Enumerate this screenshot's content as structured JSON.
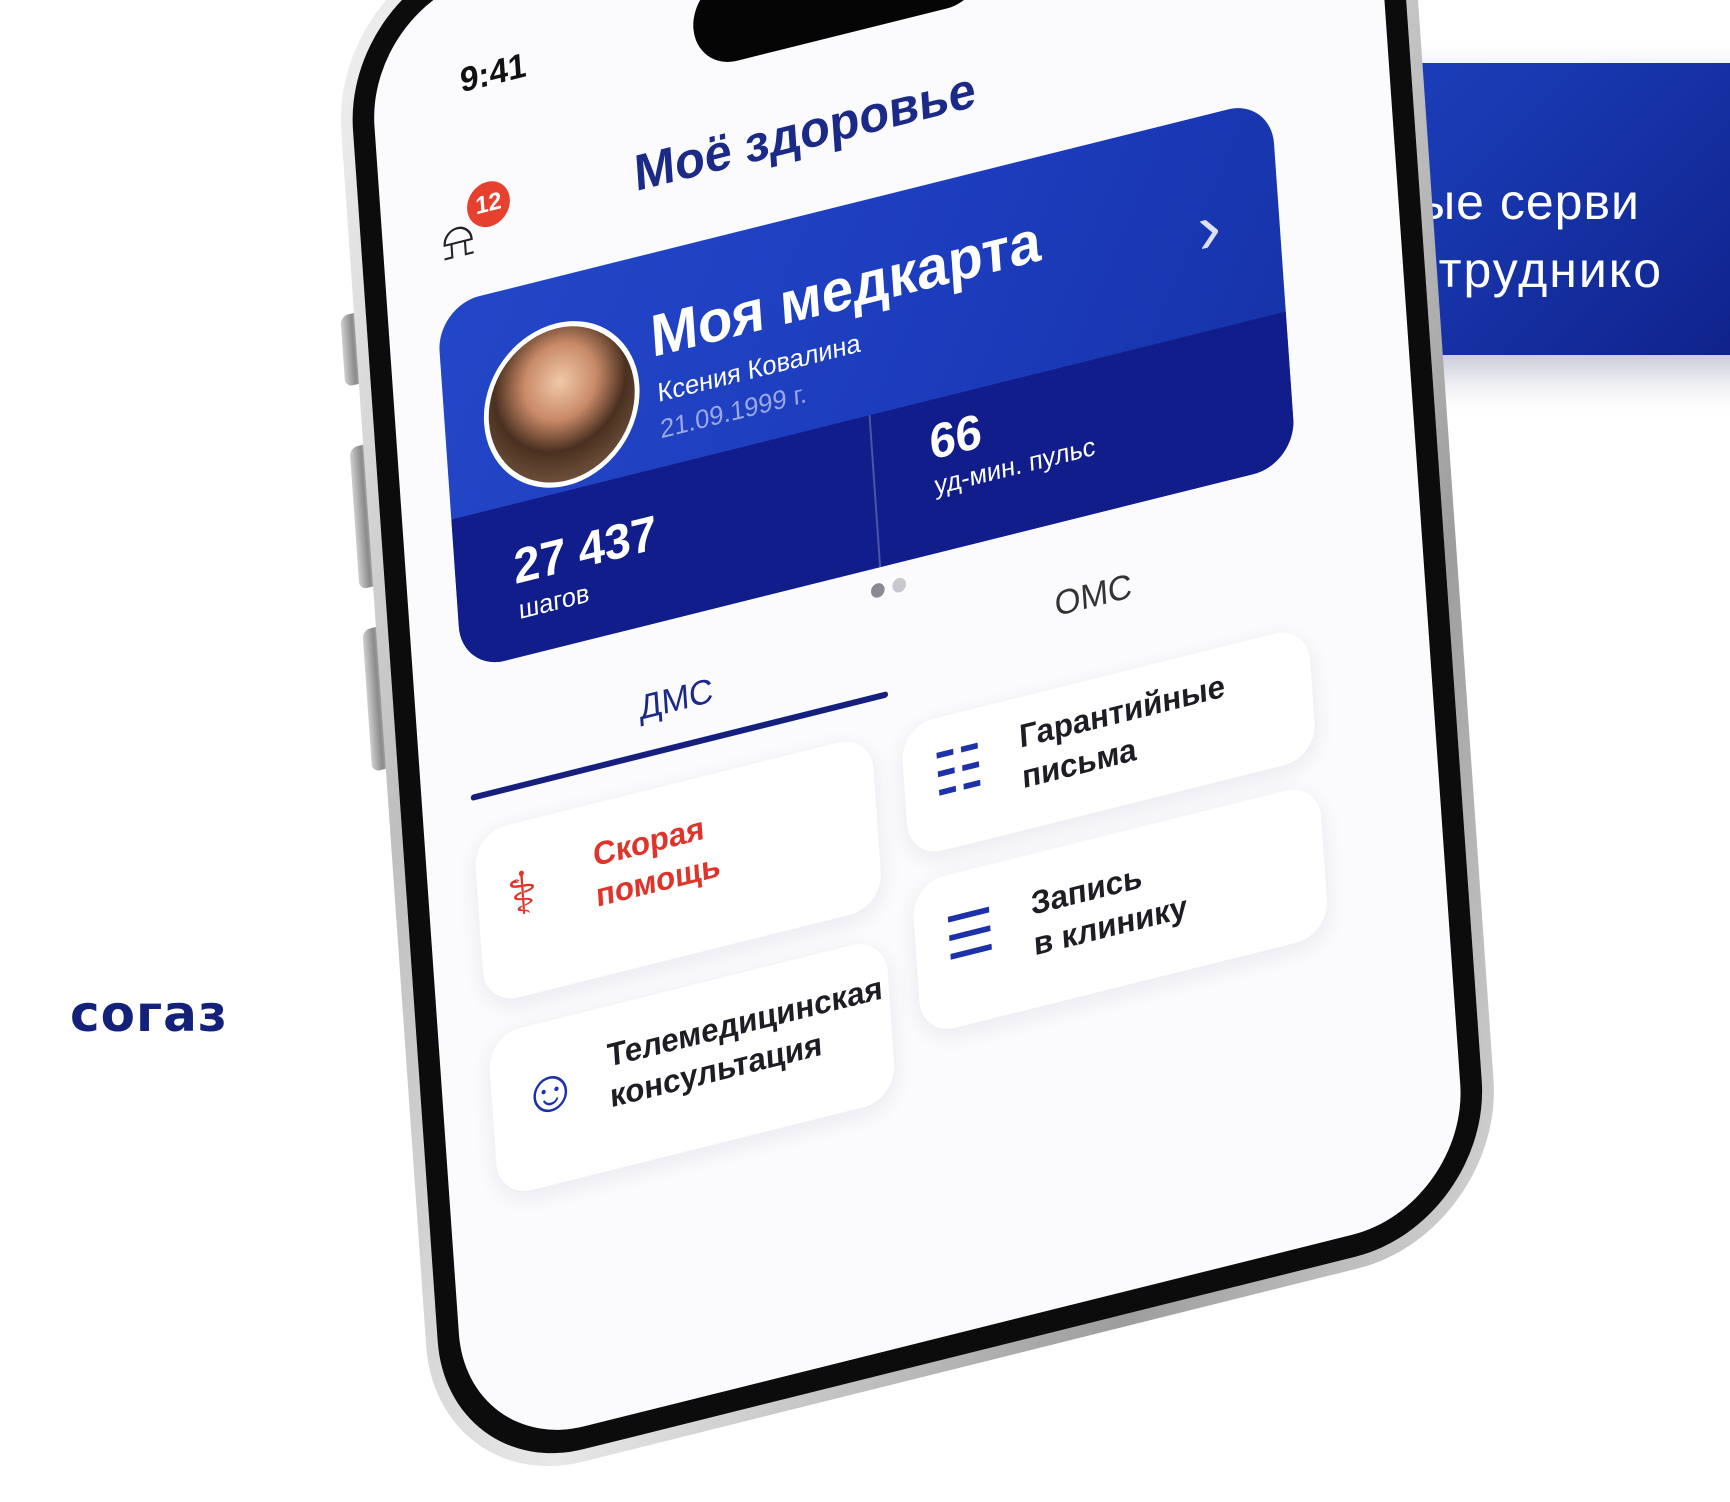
{
  "banner": {
    "line1": "Цифровые серви",
    "line2": "для сотруднико"
  },
  "logo": {
    "text": "согаз"
  },
  "status": {
    "time": "9:41"
  },
  "header": {
    "title": "Моё здоровье",
    "notifications_count": "12"
  },
  "med_card": {
    "title": "Моя медкарта",
    "name": "Ксения Ковалина",
    "dob": "21.09.1999 г.",
    "steps_value": "27 437",
    "steps_label": "шагов",
    "pulse_value": "66",
    "pulse_label": "уд-мин. пульс"
  },
  "tabs": [
    {
      "label": "ДМС",
      "active": true
    },
    {
      "label": "ОМС",
      "active": false
    }
  ],
  "tiles": {
    "ambulance": {
      "line1": "Скорая",
      "line2": "помощь",
      "icon": "ambulance-icon"
    },
    "guarantee": {
      "line1": "Гарантийные",
      "line2": "письма",
      "icon": "document-shield-icon"
    },
    "clinic": {
      "line1": "Запись",
      "line2": "в клинику",
      "icon": "clipboard-plus-icon"
    },
    "telemed": {
      "line1": "Телемедицинская",
      "line2": "консультация",
      "icon": "people-icon"
    }
  },
  "colors": {
    "brand_blue": "#1b2a86",
    "card_blue": "#2347c8",
    "card_dark": "#111d8a",
    "alert_red": "#e0332a",
    "badge_red": "#e6402f"
  }
}
